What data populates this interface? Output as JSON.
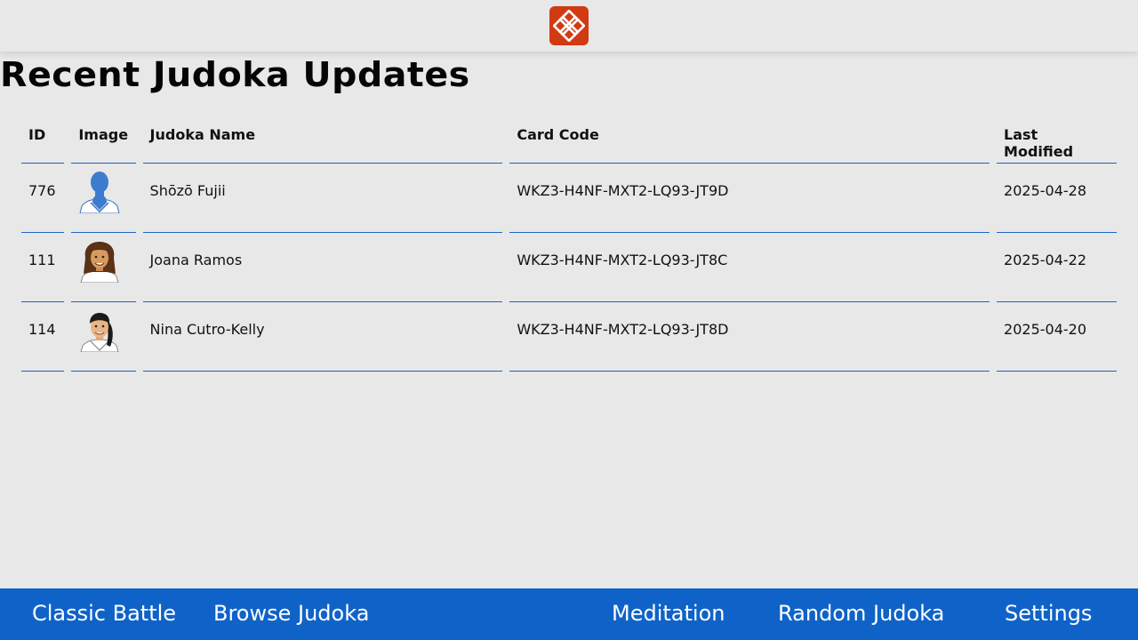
{
  "header": {
    "logo_icon": "knot-emblem-icon",
    "logo_color": "#d13a12"
  },
  "page": {
    "title": "Recent Judoka Updates"
  },
  "table": {
    "columns": {
      "id": "ID",
      "image": "Image",
      "name": "Judoka Name",
      "code": "Card Code",
      "modified": "Last Modified"
    },
    "rows": [
      {
        "id": "776",
        "avatar": "placeholder-silhouette",
        "name": "Shōzō Fujii",
        "code": "WKZ3-H4NF-MXT2-LQ93-JT9D",
        "modified": "2025-04-28"
      },
      {
        "id": "111",
        "avatar": "long-hair-portrait",
        "name": "Joana Ramos",
        "code": "WKZ3-H4NF-MXT2-LQ93-JT8C",
        "modified": "2025-04-22"
      },
      {
        "id": "114",
        "avatar": "ponytail-portrait",
        "name": "Nina Cutro-Kelly",
        "code": "WKZ3-H4NF-MXT2-LQ93-JT8D",
        "modified": "2025-04-20"
      }
    ]
  },
  "nav": {
    "items": [
      "Classic Battle",
      "Browse Judoka",
      "Meditation",
      "Random Judoka",
      "Settings"
    ],
    "color": "#0f63c8"
  }
}
